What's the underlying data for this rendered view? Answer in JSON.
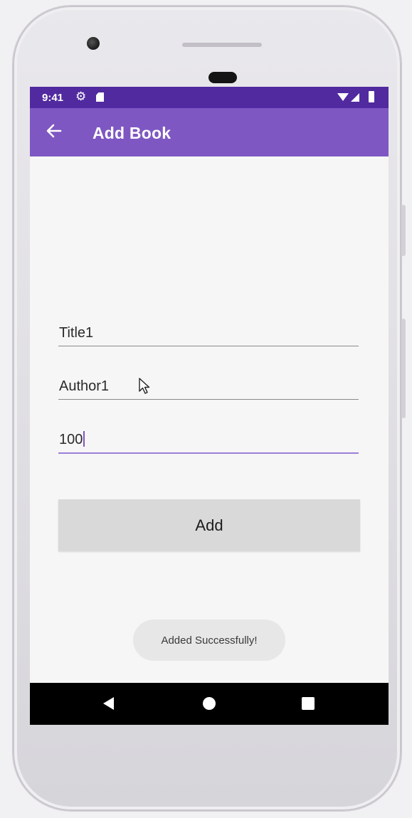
{
  "status_bar": {
    "time": "9:41",
    "icons": [
      "gear-icon",
      "sd-card-icon",
      "wifi-icon",
      "signal-icon",
      "battery-icon"
    ]
  },
  "app_bar": {
    "title": "Add Book",
    "back_icon": "arrow-left-icon",
    "color": "#7e57c2",
    "status_color": "#512aa0"
  },
  "form": {
    "title_value": "Title1",
    "author_value": "Author1",
    "number_value": "100"
  },
  "add_button": {
    "label": "Add"
  },
  "toast": {
    "message": "Added Successfully!"
  },
  "nav_bar": {
    "icons": [
      "back-triangle-icon",
      "home-circle-icon",
      "recents-square-icon"
    ]
  }
}
